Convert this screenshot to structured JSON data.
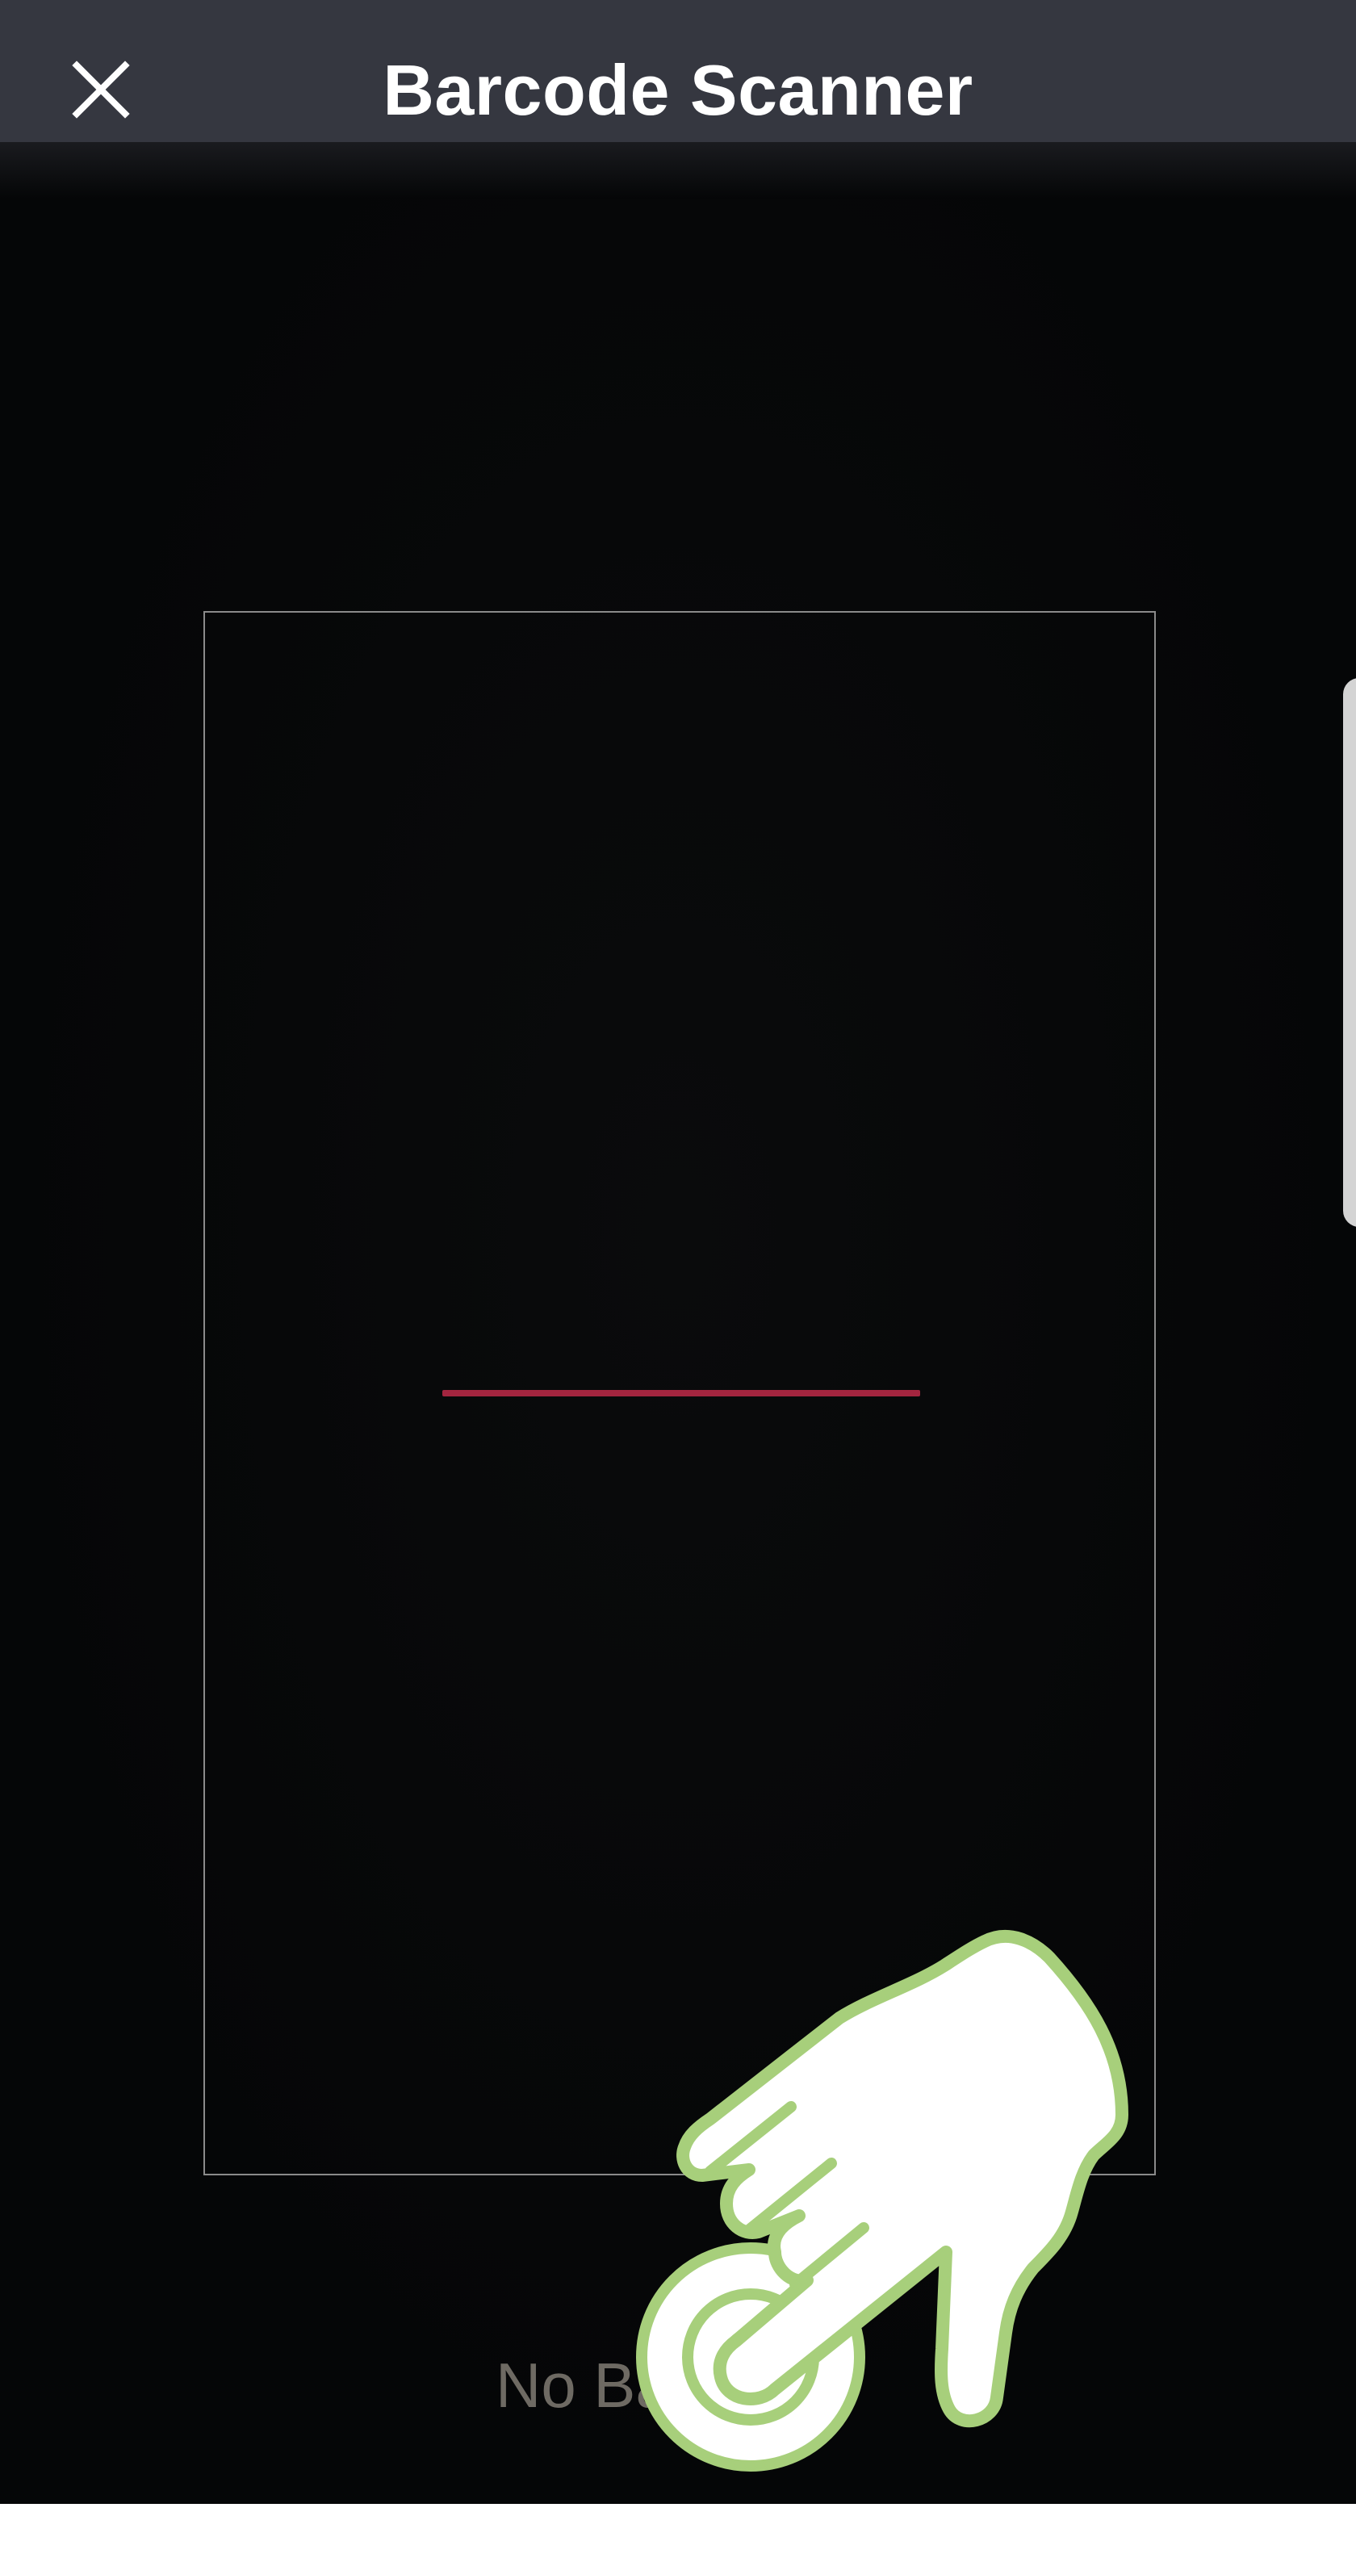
{
  "header": {
    "title": "Barcode Scanner",
    "close_icon": "close-icon"
  },
  "scanner": {
    "scan_line_color": "#a3253f",
    "frame_color": "#8a8a8a",
    "status_text": "No Ba"
  },
  "overlay": {
    "gesture_icon": "tap-gesture-icon",
    "accent_color": "#a7cf7b"
  },
  "colors": {
    "top_bar": "#353740",
    "background": "#050607"
  }
}
